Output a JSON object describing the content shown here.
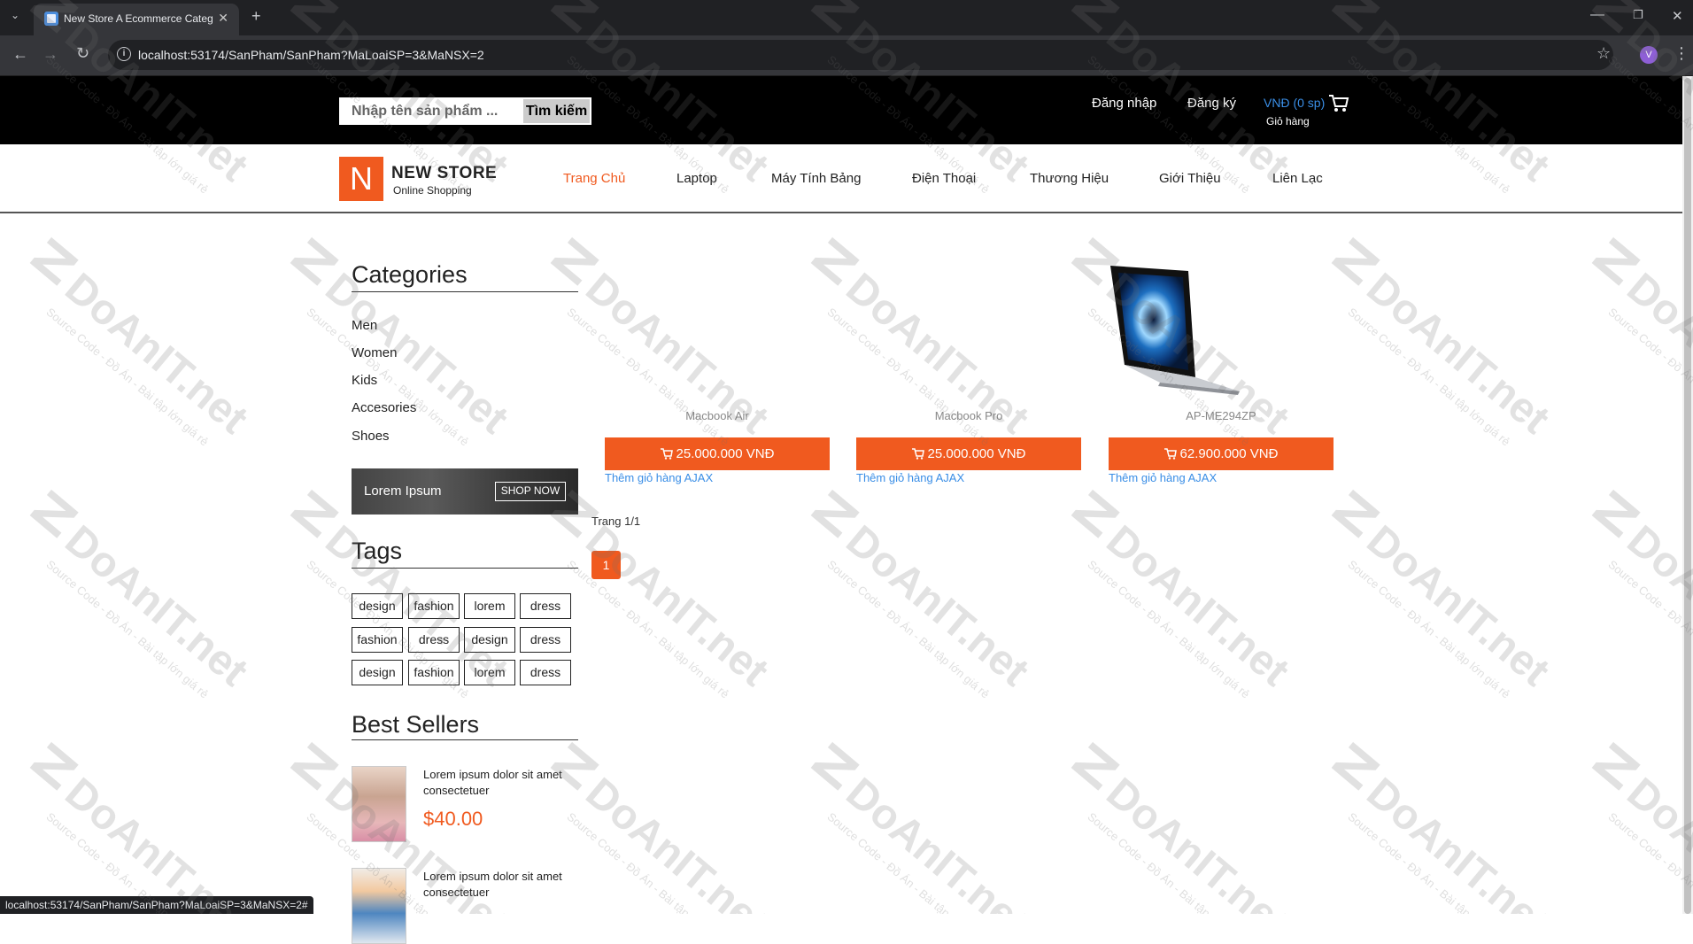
{
  "browser": {
    "tab_title": "New Store A Ecommerce Categ",
    "url": "localhost:53174/SanPham/SanPham?MaLoaiSP=3&MaNSX=2",
    "avatar_letter": "V",
    "status_url": "localhost:53174/SanPham/SanPham?MaLoaiSP=3&MaNSX=2#"
  },
  "header": {
    "search_placeholder": "Nhập tên sản phẩm ...",
    "search_button": "Tìm kiếm",
    "login": "Đăng nhập",
    "register": "Đăng ký",
    "cart_price": "VNĐ (0 sp)",
    "cart_label": "Giỏ hàng"
  },
  "brand": {
    "logo_letter": "N",
    "name": "NEW STORE",
    "tagline": "Online Shopping"
  },
  "nav": [
    "Trang Chủ",
    "Laptop",
    "Máy Tính Bảng",
    "Điện Thoại",
    "Thương Hiệu",
    "Giới Thiệu",
    "Liên Lạc"
  ],
  "sidebar": {
    "categories_title": "Categories",
    "categories": [
      "Men",
      "Women",
      "Kids",
      "Accesories",
      "Shoes"
    ],
    "banner_text": "Lorem Ipsum",
    "banner_button": "SHOP NOW",
    "tags_title": "Tags",
    "tags": [
      "design",
      "fashion",
      "lorem",
      "dress",
      "fashion",
      "dress",
      "design",
      "dress",
      "design",
      "fashion",
      "lorem",
      "dress"
    ],
    "best_title": "Best Sellers",
    "best": [
      {
        "text": "Lorem ipsum dolor sit amet consectetuer",
        "price": "$40.00"
      },
      {
        "text": "Lorem ipsum dolor sit amet consectetuer",
        "price": ""
      }
    ]
  },
  "products": [
    {
      "name": "Macbook Air",
      "price": "25.000.000 VNĐ",
      "add": "Thêm giỏ hàng AJAX"
    },
    {
      "name": "Macbook Pro",
      "price": "25.000.000 VNĐ",
      "add": "Thêm giỏ hàng AJAX"
    },
    {
      "name": "AP-ME294ZP",
      "price": "62.900.000 VNĐ",
      "add": "Thêm giỏ hàng AJAX"
    }
  ],
  "pagination": {
    "info": "Trang 1/1",
    "current": "1"
  },
  "watermark": {
    "brand": "DoAnIT.net",
    "sub": "Source Code - Đồ Án - Bài tập lớn giá rẻ"
  },
  "colors": {
    "accent": "#f05a1f",
    "link": "#3a8ee6",
    "topbar": "#000000"
  }
}
